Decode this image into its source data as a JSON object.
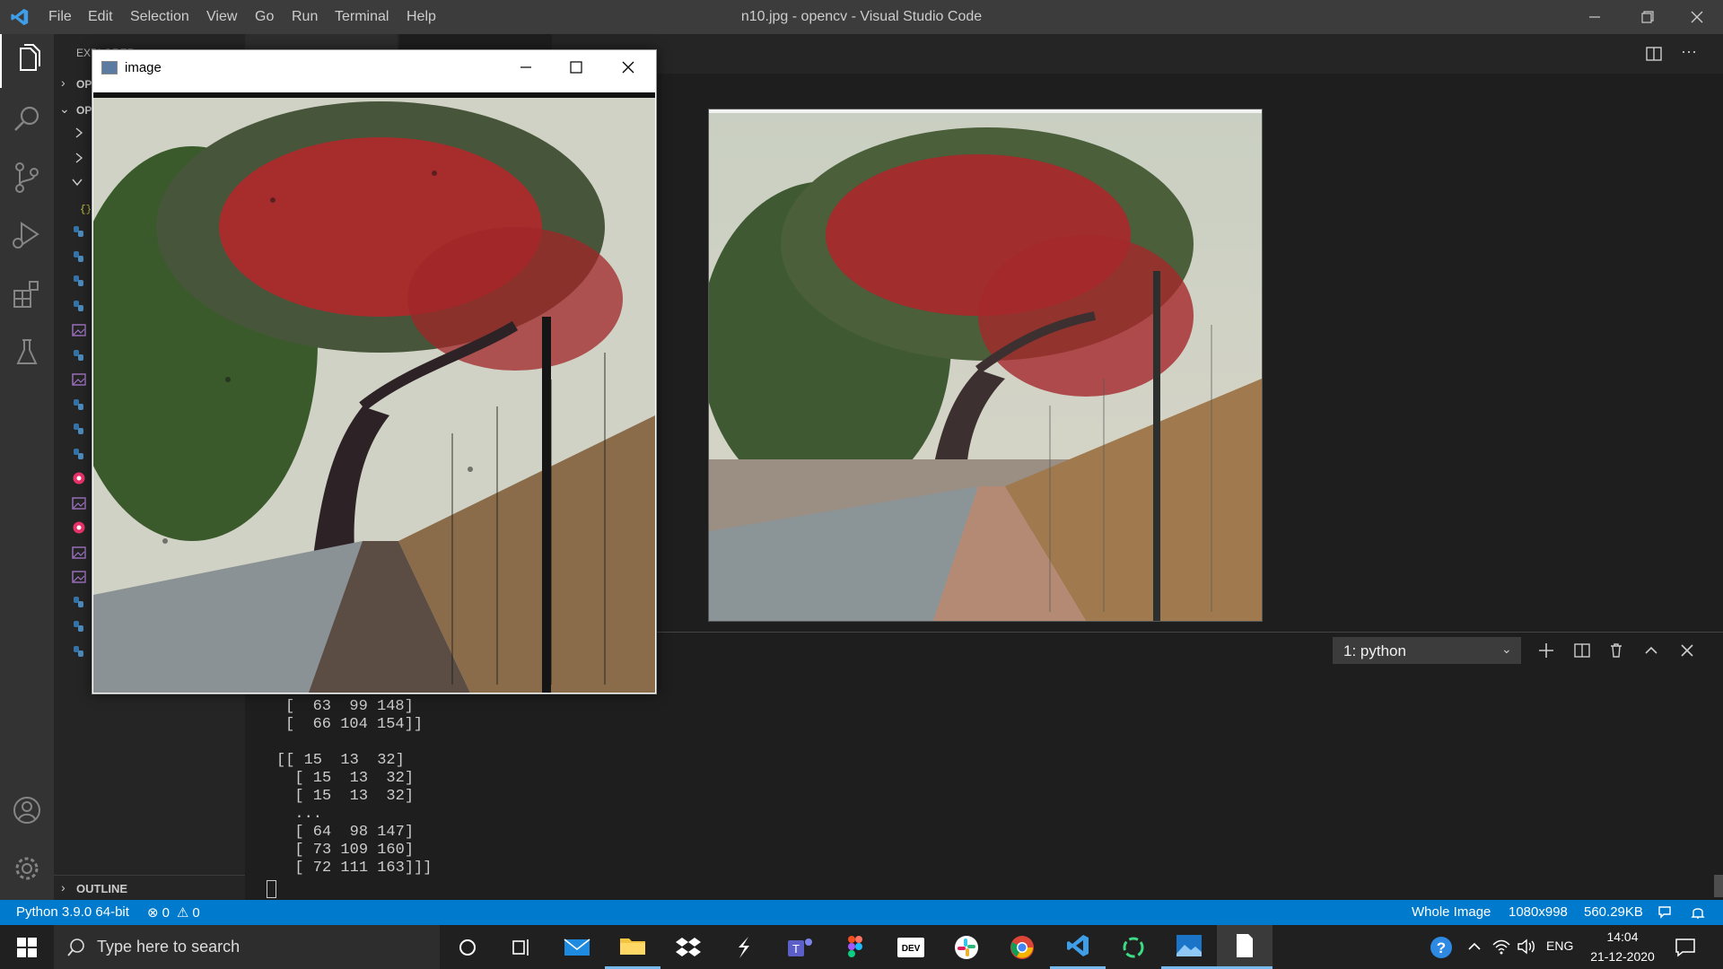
{
  "window": {
    "title": "n10.jpg - opencv - Visual Studio Code"
  },
  "menu": [
    "File",
    "Edit",
    "Selection",
    "View",
    "Go",
    "Run",
    "Terminal",
    "Help"
  ],
  "sidebar": {
    "explorer_label": "EXPLORER",
    "op1": "OP",
    "op2": "OP",
    "outline": "OUTLINE"
  },
  "image_window": {
    "title": "image"
  },
  "terminal": {
    "dropdown": "1: python",
    "lines": [
      "[  63  99 148]",
      "[  66 104 154]]",
      "",
      "[[ 15  13  32]",
      "  [ 15  13  32]",
      "  [ 15  13  32]",
      "  ...",
      "  [ 64  98 147]",
      "  [ 73 109 160]",
      "  [ 72 111 163]]]"
    ]
  },
  "status": {
    "python": "Python 3.9.0 64-bit",
    "errors": "0",
    "warnings": "0",
    "whole_image": "Whole Image",
    "dims": "1080x998",
    "size": "560.29KB"
  },
  "taskbar": {
    "search_placeholder": "Type here to search",
    "lang": "ENG",
    "time": "14:04",
    "date": "21-12-2020"
  },
  "colors": {
    "accent": "#007acc",
    "titlebar": "#3c3c3c",
    "activity": "#333333",
    "sidebar": "#252526",
    "editor": "#1e1e1e",
    "taskbar": "#202020"
  }
}
